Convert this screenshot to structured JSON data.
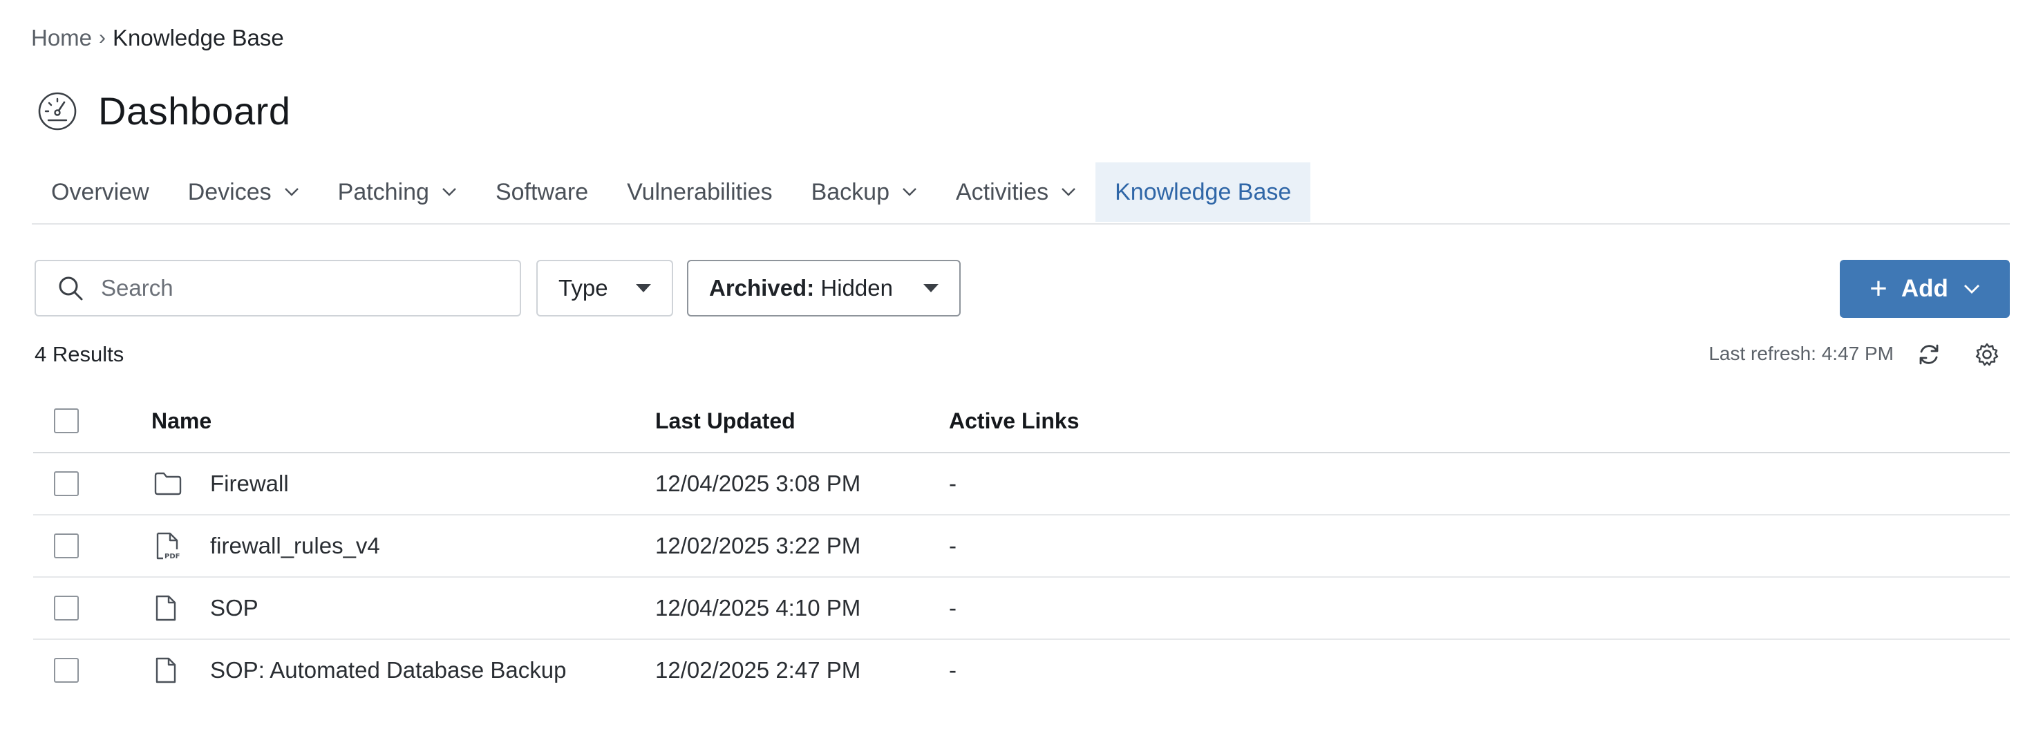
{
  "breadcrumb": {
    "home": "Home",
    "separator": "›",
    "current": "Knowledge Base"
  },
  "page": {
    "title": "Dashboard",
    "icon": "dashboard-gauge-icon"
  },
  "tabs": [
    {
      "label": "Overview",
      "has_dropdown": false
    },
    {
      "label": "Devices",
      "has_dropdown": true
    },
    {
      "label": "Patching",
      "has_dropdown": true
    },
    {
      "label": "Software",
      "has_dropdown": false
    },
    {
      "label": "Vulnerabilities",
      "has_dropdown": false
    },
    {
      "label": "Backup",
      "has_dropdown": true
    },
    {
      "label": "Activities",
      "has_dropdown": true
    },
    {
      "label": "Knowledge Base",
      "has_dropdown": false,
      "active": true
    }
  ],
  "toolbar": {
    "search_placeholder": "Search",
    "type_label": "Type",
    "archived_key": "Archived:",
    "archived_value": "Hidden",
    "add_label": "Add"
  },
  "summary": {
    "results": "4 Results",
    "last_refresh": "Last refresh: 4:47 PM"
  },
  "table": {
    "headers": {
      "name": "Name",
      "last_updated": "Last Updated",
      "active_links": "Active Links"
    },
    "rows": [
      {
        "icon": "folder-icon",
        "name": "Firewall",
        "last_updated": "12/04/2025 3:08 PM",
        "active_links": "-"
      },
      {
        "icon": "pdf-file-icon",
        "name": "firewall_rules_v4",
        "last_updated": "12/02/2025 3:22 PM",
        "active_links": "-"
      },
      {
        "icon": "document-icon",
        "name": "SOP",
        "last_updated": "12/04/2025 4:10 PM",
        "active_links": "-"
      },
      {
        "icon": "document-icon",
        "name": "SOP: Automated Database Backup",
        "last_updated": "12/02/2025 2:47 PM",
        "active_links": "-"
      }
    ]
  },
  "colors": {
    "accent": "#3f78b5",
    "active_tab_bg": "#eaf1f8",
    "active_tab_text": "#2f66a7"
  }
}
